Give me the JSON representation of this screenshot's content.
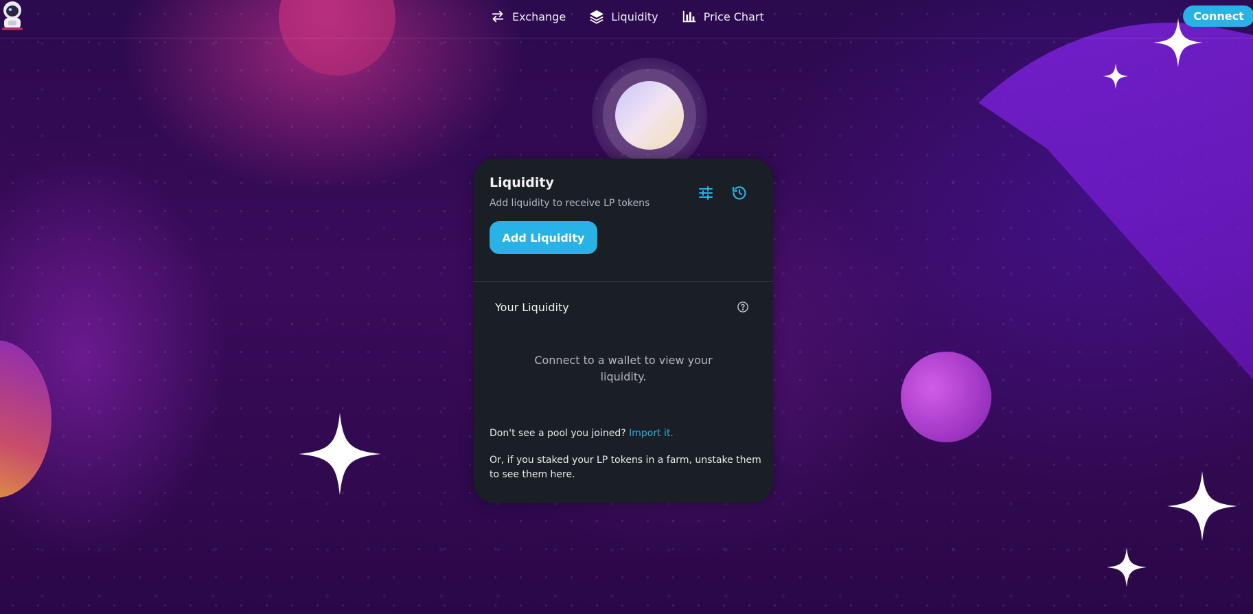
{
  "header": {
    "nav": [
      {
        "label": "Exchange",
        "icon": "swap-arrows-icon"
      },
      {
        "label": "Liquidity",
        "icon": "layers-icon"
      },
      {
        "label": "Price Chart",
        "icon": "bar-chart-icon"
      }
    ],
    "connect_label": "Connect"
  },
  "card": {
    "title": "Liquidity",
    "subtitle": "Add liquidity to receive LP tokens",
    "add_liquidity_label": "Add Liquidity",
    "your_liquidity_label": "Your Liquidity",
    "connect_message": "Connect to a wallet to view your liquidity.",
    "pool_question": "Don't see a pool you joined?",
    "import_link": "Import it.",
    "staked_message": "Or, if you staked your LP tokens in a farm, unstake them to see them here."
  },
  "colors": {
    "accent": "#28b2e6",
    "card_bg": "#1a1e25",
    "page_bg": "#2b0a4e"
  }
}
